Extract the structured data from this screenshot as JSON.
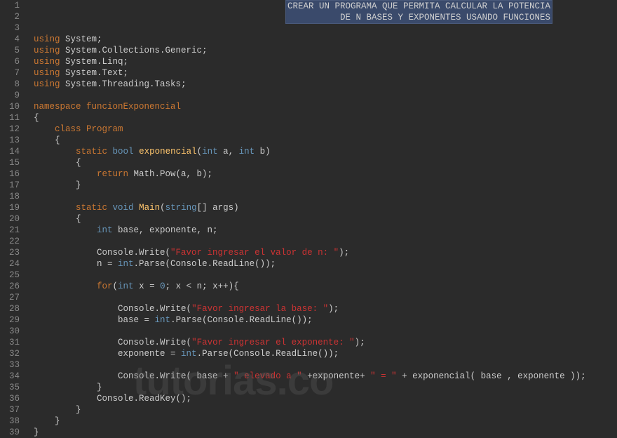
{
  "comment_block": {
    "line1": "CREAR UN PROGRAMA QUE PERMITA CALCULAR LA POTENCIA",
    "line2": "DE N BASES Y EXPONENTES USANDO FUNCIONES"
  },
  "watermark": "tutorias.co",
  "line_count": 39,
  "code": {
    "l4": {
      "using": "using",
      "ns": "System",
      "semi": ";"
    },
    "l5": {
      "using": "using",
      "ns": "System.Collections.Generic",
      "semi": ";"
    },
    "l6": {
      "using": "using",
      "ns": "System.Linq",
      "semi": ";"
    },
    "l7": {
      "using": "using",
      "ns": "System.Text",
      "semi": ";"
    },
    "l8": {
      "using": "using",
      "ns": "System.Threading.Tasks",
      "semi": ";"
    },
    "l10": {
      "kw": "namespace",
      "name": "funcionExponencial"
    },
    "l11": {
      "brace": "{"
    },
    "l12": {
      "kw": "class",
      "name": "Program"
    },
    "l13": {
      "brace": "{"
    },
    "l14": {
      "kw1": "static",
      "kw2": "bool",
      "method": "exponencial",
      "open": "(",
      "t1": "int",
      "a": " a, ",
      "t2": "int",
      "b": " b)",
      "close": ""
    },
    "l15": {
      "brace": "{"
    },
    "l16": {
      "kw": "return",
      "rest": " Math.Pow(a, b);"
    },
    "l17": {
      "brace": "}"
    },
    "l19": {
      "kw1": "static",
      "kw2": "void",
      "method": "Main",
      "open": "(",
      "t1": "string",
      "rest": "[] args)"
    },
    "l20": {
      "brace": "{"
    },
    "l21": {
      "t": "int",
      "rest": " base, exponente, n;"
    },
    "l23": {
      "pre": "Console.Write(",
      "str": "\"Favor ingresar el valor de n: \"",
      "post": ");"
    },
    "l24": {
      "pre": "n = ",
      "t": "int",
      "post": ".Parse(Console.ReadLine());"
    },
    "l26": {
      "kw": "for",
      "open": "(",
      "t": "int",
      "mid": " x = ",
      "num": "0",
      "rest": "; x < n; x++){"
    },
    "l28": {
      "pre": "Console.Write(",
      "str": "\"Favor ingresar la base: \"",
      "post": ");"
    },
    "l29": {
      "pre": "base = ",
      "t": "int",
      "post": ".Parse(Console.ReadLine());"
    },
    "l31": {
      "pre": "Console.Write(",
      "str": "\"Favor ingresar el exponente: \"",
      "post": ");"
    },
    "l32": {
      "pre": "exponente = ",
      "t": "int",
      "post": ".Parse(Console.ReadLine());"
    },
    "l34": {
      "pre": "Console.Write( base + ",
      "str1": "\" elevado a \"",
      "mid": " +exponente+ ",
      "str2": "\" = \"",
      "post": " + exponencial( base , exponente ));"
    },
    "l35": {
      "brace": "}"
    },
    "l36": {
      "text": "Console.ReadKey();"
    },
    "l37": {
      "brace": "}"
    },
    "l38": {
      "brace": "}"
    },
    "l39": {
      "brace": "}"
    }
  }
}
